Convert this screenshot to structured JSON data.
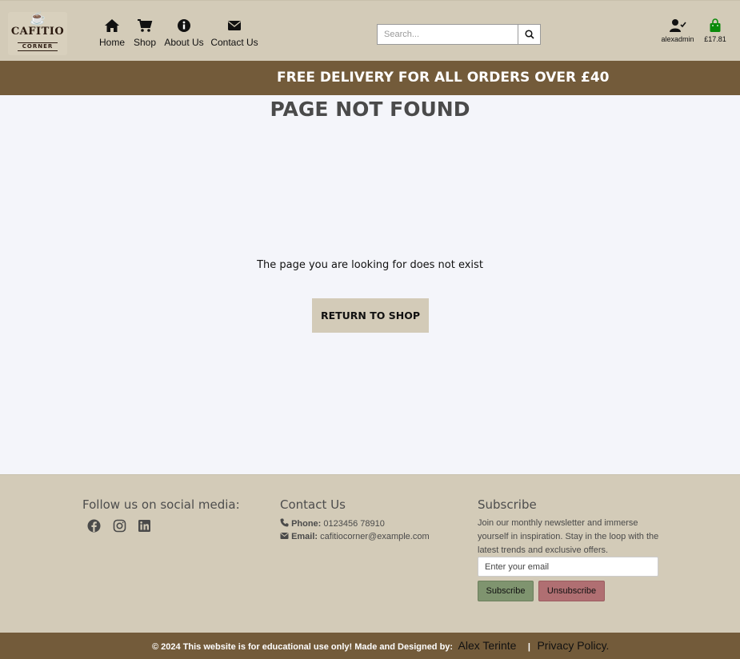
{
  "header": {
    "logo": {
      "line1": "CAFITIO",
      "line2": "CORNER"
    },
    "nav": [
      {
        "label": "Home",
        "icon": "home-icon"
      },
      {
        "label": "Shop",
        "icon": "cart-icon"
      },
      {
        "label": "About Us",
        "icon": "info-icon"
      },
      {
        "label": "Contact Us",
        "icon": "envelope-icon"
      }
    ],
    "search": {
      "placeholder": "Search..."
    },
    "account": {
      "username": "alexadmin"
    },
    "bag": {
      "total": "£17.81",
      "color": "#0a8a0a"
    }
  },
  "banner": {
    "text": "FREE DELIVERY FOR ALL ORDERS OVER £40"
  },
  "main": {
    "title": "PAGE NOT FOUND",
    "message": "The page you are looking for does not exist",
    "button_label": "RETURN TO SHOP"
  },
  "footer": {
    "social_heading": "Follow us on social media:",
    "social_icons": [
      "facebook-icon",
      "instagram-icon",
      "linkedin-icon"
    ],
    "contact_heading": "Contact Us",
    "phone_label": "Phone:",
    "phone": "0123456 78910",
    "email_label": "Email:",
    "email": "cafitiocorner@example.com",
    "subscribe_heading": "Subscribe",
    "subscribe_text": "Join our monthly newsletter and immerse yourself in inspiration. Stay in the loop with the latest trends and exclusive offers.",
    "email_placeholder": "Enter your email",
    "subscribe_button": "Subscribe",
    "unsubscribe_button": "Unsubscribe"
  },
  "copyright": {
    "text": "© 2024 This website is for educational use only! Made and Designed by:",
    "author": "Alex Terinte",
    "separator": "|",
    "privacy": "Privacy Policy."
  },
  "colors": {
    "header_bg": "#d3cbb8",
    "banner_bg": "#735b3a",
    "page_bg": "#f4f5fa",
    "subscribe_bg": "#7f946f",
    "unsubscribe_bg": "#b06f72"
  }
}
